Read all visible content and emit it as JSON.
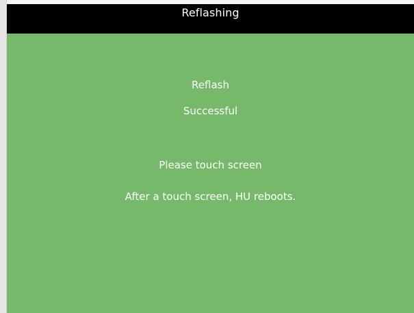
{
  "header": {
    "title": "Reflashing"
  },
  "status": {
    "line1": "Reflash",
    "line2": "Successful",
    "instruction": "Please touch screen",
    "note": "After a touch screen, HU reboots."
  },
  "colors": {
    "background": "#76b96b",
    "titlebar": "#000000",
    "text": "#ffffff"
  }
}
